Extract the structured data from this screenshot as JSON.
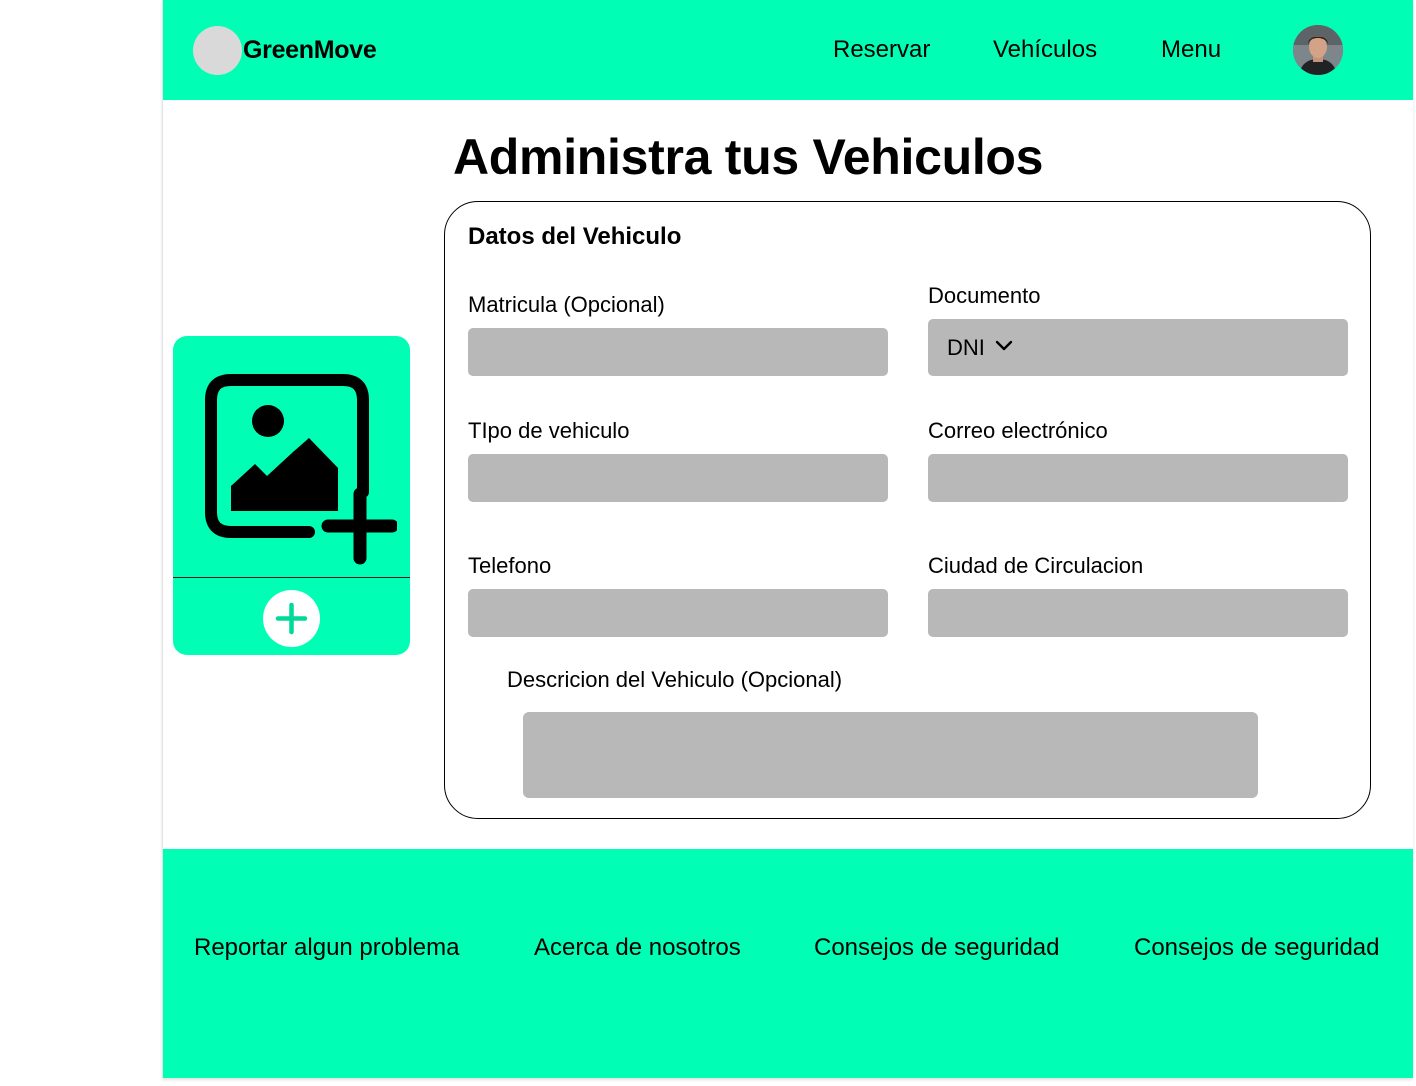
{
  "colors": {
    "brand_green": "#00ffb4",
    "input_gray": "#b8b8b8",
    "logo_placeholder": "#d9d9d9"
  },
  "header": {
    "brand": "GreenMove",
    "nav": [
      {
        "label": "Reservar"
      },
      {
        "label": "Vehículos"
      },
      {
        "label": "Menu"
      }
    ],
    "avatar_icon": "user-avatar-photo"
  },
  "main": {
    "title": "Administra tus Vehiculos",
    "upload": {
      "image_icon": "add-image-icon",
      "add_icon": "plus-circle-icon"
    },
    "form": {
      "heading": "Datos del Vehiculo",
      "fields": {
        "matricula": {
          "label": "Matricula (Opcional)",
          "value": ""
        },
        "documento": {
          "label": "Documento",
          "value": "DNI",
          "icon": "chevron-down-icon"
        },
        "tipo": {
          "label": "TIpo de vehiculo",
          "value": ""
        },
        "correo": {
          "label": "Correo electrónico",
          "value": ""
        },
        "telefono": {
          "label": "Telefono",
          "value": ""
        },
        "ciudad": {
          "label": "Ciudad de Circulacion",
          "value": ""
        },
        "descripcion": {
          "label": "Descricion del Vehiculo (Opcional)",
          "value": ""
        }
      }
    }
  },
  "footer": {
    "links": [
      {
        "label": "Reportar algun problema"
      },
      {
        "label": "Acerca de nosotros"
      },
      {
        "label": "Consejos de seguridad"
      },
      {
        "label": "Consejos de seguridad"
      }
    ]
  }
}
